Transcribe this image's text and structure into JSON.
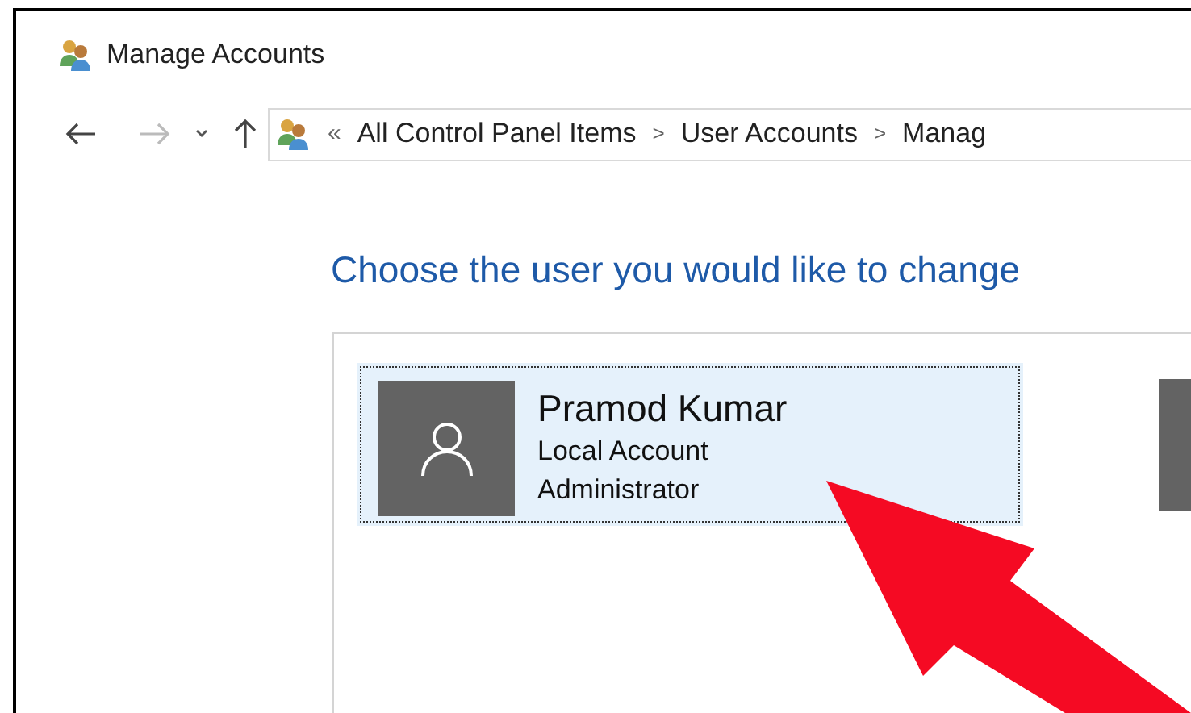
{
  "window": {
    "title": "Manage Accounts"
  },
  "address_bar": {
    "overflow": "«",
    "crumbs": [
      "All Control Panel Items",
      "User Accounts",
      "Manag"
    ],
    "separator": ">"
  },
  "heading": "Choose the user you would like to change",
  "accounts": [
    {
      "name": "Pramod Kumar",
      "type": "Local Account",
      "role": "Administrator",
      "selected": true
    }
  ]
}
